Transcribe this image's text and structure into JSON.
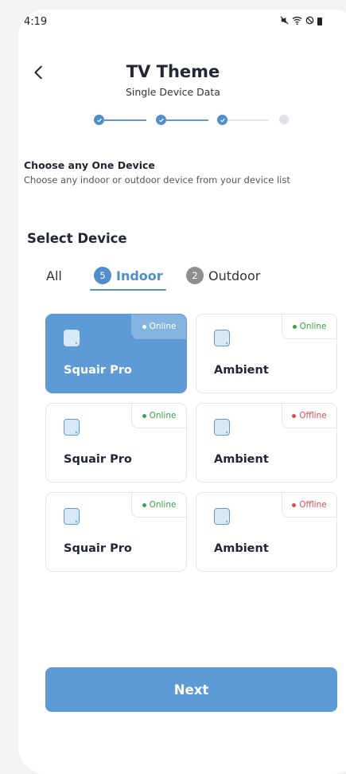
{
  "status_bar": {
    "time": "4:19"
  },
  "header": {
    "title": "TV Theme",
    "subtitle": "Single Device Data"
  },
  "stepper": {
    "total_steps": 4,
    "completed_steps": 3
  },
  "instructions": {
    "heading": "Choose any One Device",
    "description": "Choose any indoor or outdoor device from your device list"
  },
  "select_device": {
    "heading": "Select Device",
    "tabs": [
      {
        "label": "All",
        "count": "",
        "active": false
      },
      {
        "label": "Indoor",
        "count": "5",
        "active": true
      },
      {
        "label": "Outdoor",
        "count": "2",
        "active": false
      }
    ]
  },
  "devices": [
    {
      "name": "Squair Pro",
      "status": "Online",
      "selected": true
    },
    {
      "name": "Ambient",
      "status": "Online",
      "selected": false
    },
    {
      "name": "Squair Pro",
      "status": "Online",
      "selected": false
    },
    {
      "name": "Ambient",
      "status": "Offline",
      "selected": false
    },
    {
      "name": "Squair Pro",
      "status": "Online",
      "selected": false
    },
    {
      "name": "Ambient",
      "status": "Offline",
      "selected": false
    }
  ],
  "footer": {
    "next_label": "Next"
  },
  "colors": {
    "accent": "#5e9bd6",
    "online": "#3aa34a",
    "offline": "#e2494e"
  }
}
